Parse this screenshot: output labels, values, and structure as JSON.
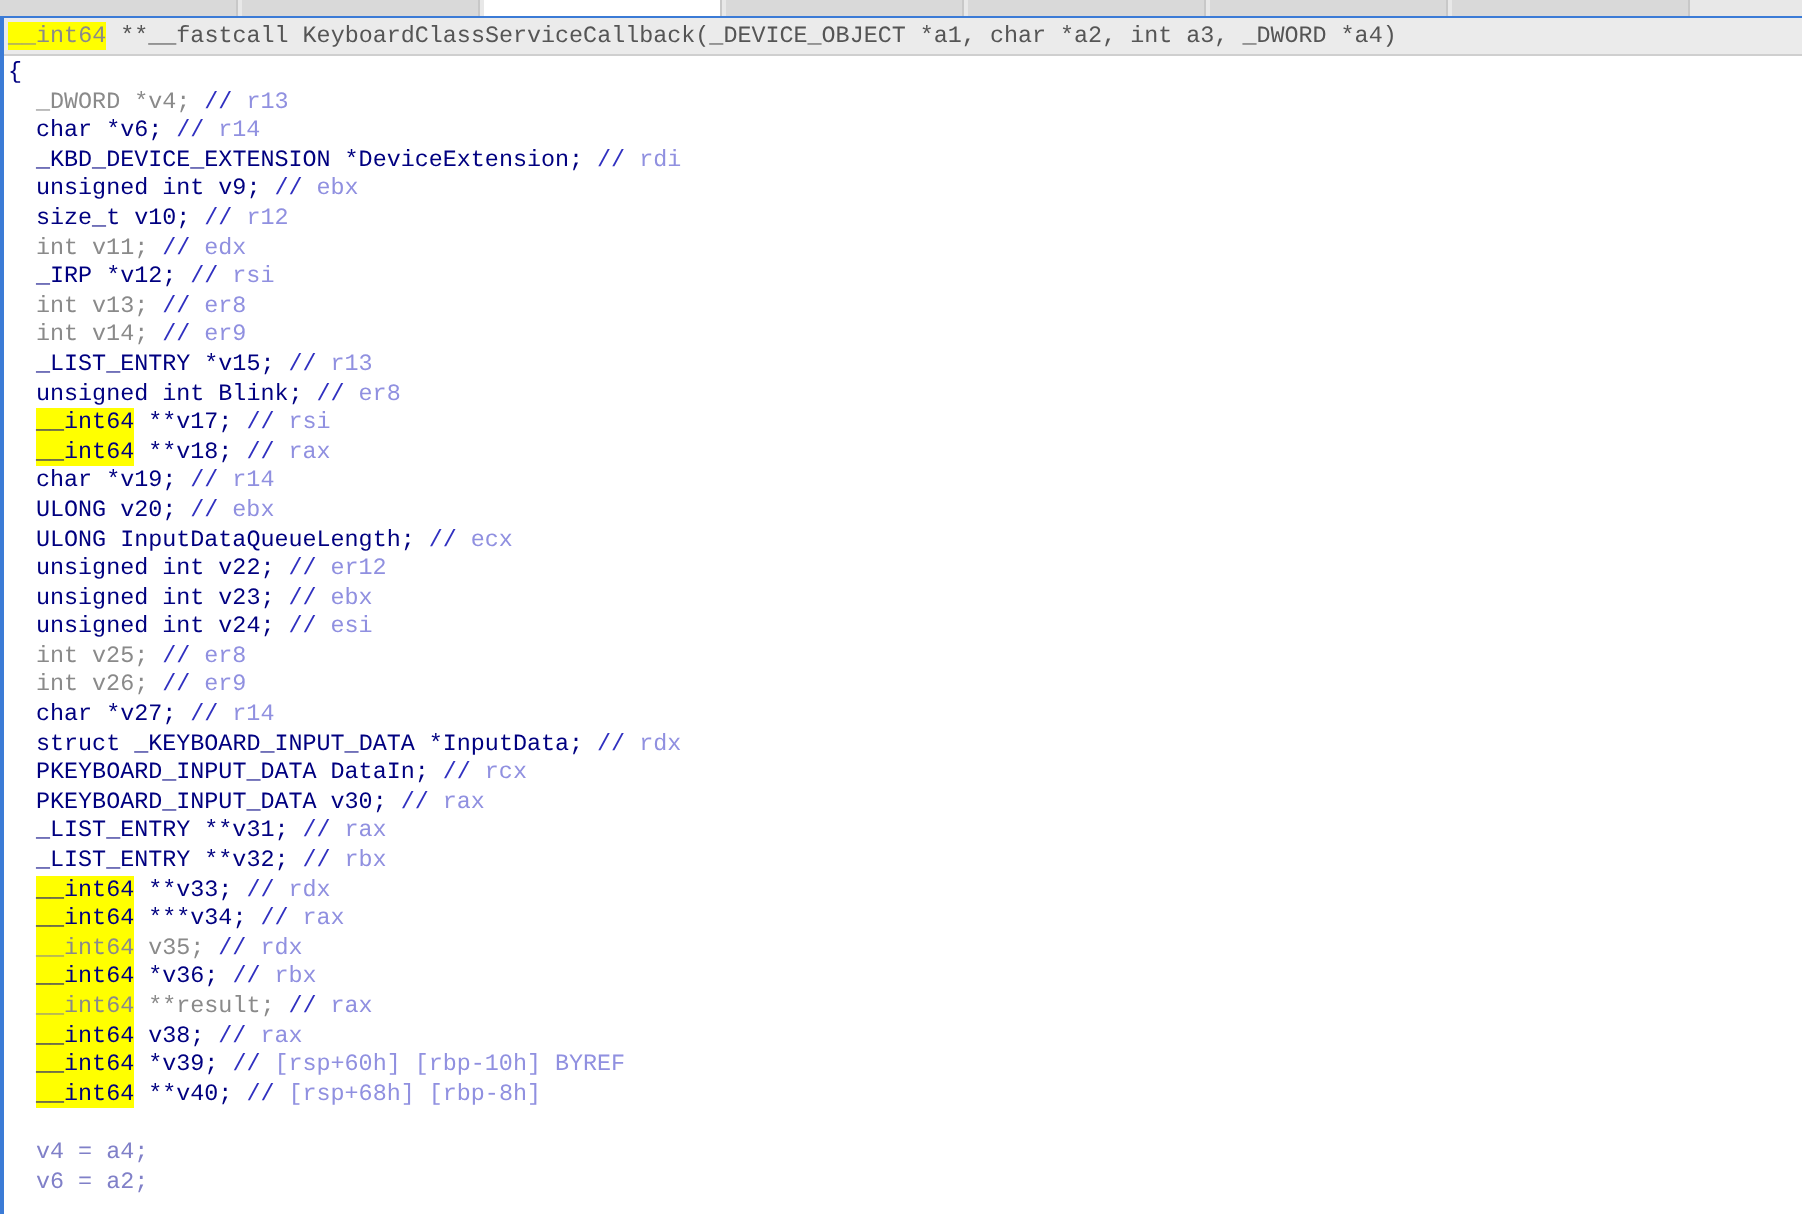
{
  "header": {
    "return_type": "__int64",
    "return_type_highlighted": true,
    "signature": "**__fastcall KeyboardClassServiceCallback(_DEVICE_OBJECT *a1, char *a2, int a3, _DWORD *a4)"
  },
  "lines": [
    {
      "kind": "brace",
      "text": "{"
    },
    {
      "kind": "decl",
      "type": "_DWORD",
      "declarator": "*v4;",
      "dimmed": true,
      "highlighted": false,
      "comment_marker": "//",
      "comment": "r13"
    },
    {
      "kind": "decl",
      "type": "char",
      "declarator": "*v6;",
      "dimmed": false,
      "highlighted": false,
      "comment_marker": "//",
      "comment": "r14"
    },
    {
      "kind": "decl",
      "type": "_KBD_DEVICE_EXTENSION",
      "declarator": "*DeviceExtension;",
      "dimmed": false,
      "highlighted": false,
      "comment_marker": "//",
      "comment": "rdi"
    },
    {
      "kind": "decl",
      "type": "unsigned int",
      "declarator": "v9;",
      "dimmed": false,
      "highlighted": false,
      "comment_marker": "//",
      "comment": "ebx"
    },
    {
      "kind": "decl",
      "type": "size_t",
      "declarator": "v10;",
      "dimmed": false,
      "highlighted": false,
      "comment_marker": "//",
      "comment": "r12"
    },
    {
      "kind": "decl",
      "type": "int",
      "declarator": "v11;",
      "dimmed": true,
      "highlighted": false,
      "comment_marker": "//",
      "comment": "edx"
    },
    {
      "kind": "decl",
      "type": "_IRP",
      "declarator": "*v12;",
      "dimmed": false,
      "highlighted": false,
      "comment_marker": "//",
      "comment": "rsi"
    },
    {
      "kind": "decl",
      "type": "int",
      "declarator": "v13;",
      "dimmed": true,
      "highlighted": false,
      "comment_marker": "//",
      "comment": "er8"
    },
    {
      "kind": "decl",
      "type": "int",
      "declarator": "v14;",
      "dimmed": true,
      "highlighted": false,
      "comment_marker": "//",
      "comment": "er9"
    },
    {
      "kind": "decl",
      "type": "_LIST_ENTRY",
      "declarator": "*v15;",
      "dimmed": false,
      "highlighted": false,
      "comment_marker": "//",
      "comment": "r13"
    },
    {
      "kind": "decl",
      "type": "unsigned int",
      "declarator": "Blink;",
      "dimmed": false,
      "highlighted": false,
      "comment_marker": "//",
      "comment": "er8"
    },
    {
      "kind": "decl",
      "type": "__int64",
      "declarator": "**v17;",
      "dimmed": false,
      "highlighted": true,
      "comment_marker": "//",
      "comment": "rsi"
    },
    {
      "kind": "decl",
      "type": "__int64",
      "declarator": "**v18;",
      "dimmed": false,
      "highlighted": true,
      "comment_marker": "//",
      "comment": "rax"
    },
    {
      "kind": "decl",
      "type": "char",
      "declarator": "*v19;",
      "dimmed": false,
      "highlighted": false,
      "comment_marker": "//",
      "comment": "r14"
    },
    {
      "kind": "decl",
      "type": "ULONG",
      "declarator": "v20;",
      "dimmed": false,
      "highlighted": false,
      "comment_marker": "//",
      "comment": "ebx"
    },
    {
      "kind": "decl",
      "type": "ULONG",
      "declarator": "InputDataQueueLength;",
      "dimmed": false,
      "highlighted": false,
      "comment_marker": "//",
      "comment": "ecx"
    },
    {
      "kind": "decl",
      "type": "unsigned int",
      "declarator": "v22;",
      "dimmed": false,
      "highlighted": false,
      "comment_marker": "//",
      "comment": "er12"
    },
    {
      "kind": "decl",
      "type": "unsigned int",
      "declarator": "v23;",
      "dimmed": false,
      "highlighted": false,
      "comment_marker": "//",
      "comment": "ebx"
    },
    {
      "kind": "decl",
      "type": "unsigned int",
      "declarator": "v24;",
      "dimmed": false,
      "highlighted": false,
      "comment_marker": "//",
      "comment": "esi"
    },
    {
      "kind": "decl",
      "type": "int",
      "declarator": "v25;",
      "dimmed": true,
      "highlighted": false,
      "comment_marker": "//",
      "comment": "er8"
    },
    {
      "kind": "decl",
      "type": "int",
      "declarator": "v26;",
      "dimmed": true,
      "highlighted": false,
      "comment_marker": "//",
      "comment": "er9"
    },
    {
      "kind": "decl",
      "type": "char",
      "declarator": "*v27;",
      "dimmed": false,
      "highlighted": false,
      "comment_marker": "//",
      "comment": "r14"
    },
    {
      "kind": "decl",
      "type": "struct _KEYBOARD_INPUT_DATA",
      "declarator": "*InputData;",
      "dimmed": false,
      "highlighted": false,
      "comment_marker": "//",
      "comment": "rdx"
    },
    {
      "kind": "decl",
      "type": "PKEYBOARD_INPUT_DATA",
      "declarator": "DataIn;",
      "dimmed": false,
      "highlighted": false,
      "comment_marker": "//",
      "comment": "rcx"
    },
    {
      "kind": "decl",
      "type": "PKEYBOARD_INPUT_DATA",
      "declarator": "v30;",
      "dimmed": false,
      "highlighted": false,
      "comment_marker": "//",
      "comment": "rax"
    },
    {
      "kind": "decl",
      "type": "_LIST_ENTRY",
      "declarator": "**v31;",
      "dimmed": false,
      "highlighted": false,
      "comment_marker": "//",
      "comment": "rax"
    },
    {
      "kind": "decl",
      "type": "_LIST_ENTRY",
      "declarator": "**v32;",
      "dimmed": false,
      "highlighted": false,
      "comment_marker": "//",
      "comment": "rbx"
    },
    {
      "kind": "decl",
      "type": "__int64",
      "declarator": "**v33;",
      "dimmed": false,
      "highlighted": true,
      "comment_marker": "//",
      "comment": "rdx"
    },
    {
      "kind": "decl",
      "type": "__int64",
      "declarator": "***v34;",
      "dimmed": false,
      "highlighted": true,
      "comment_marker": "//",
      "comment": "rax"
    },
    {
      "kind": "decl",
      "type": "__int64",
      "declarator": "v35;",
      "dimmed": true,
      "highlighted": true,
      "comment_marker": "//",
      "comment": "rdx"
    },
    {
      "kind": "decl",
      "type": "__int64",
      "declarator": "*v36;",
      "dimmed": false,
      "highlighted": true,
      "comment_marker": "//",
      "comment": "rbx"
    },
    {
      "kind": "decl",
      "type": "__int64",
      "declarator": "**result;",
      "dimmed": true,
      "highlighted": true,
      "comment_marker": "//",
      "comment": "rax"
    },
    {
      "kind": "decl",
      "type": "__int64",
      "declarator": "v38;",
      "dimmed": false,
      "highlighted": true,
      "comment_marker": "//",
      "comment": "rax"
    },
    {
      "kind": "decl",
      "type": "__int64",
      "declarator": "*v39;",
      "dimmed": false,
      "highlighted": true,
      "comment_marker": "//",
      "comment": "[rsp+60h] [rbp-10h] BYREF"
    },
    {
      "kind": "decl",
      "type": "__int64",
      "declarator": "**v40;",
      "dimmed": false,
      "highlighted": true,
      "comment_marker": "//",
      "comment": "[rsp+68h] [rbp-8h]"
    },
    {
      "kind": "blank"
    },
    {
      "kind": "stmt",
      "text": "v4 = a4;"
    },
    {
      "kind": "stmt",
      "text": "v6 = a2;"
    }
  ]
}
